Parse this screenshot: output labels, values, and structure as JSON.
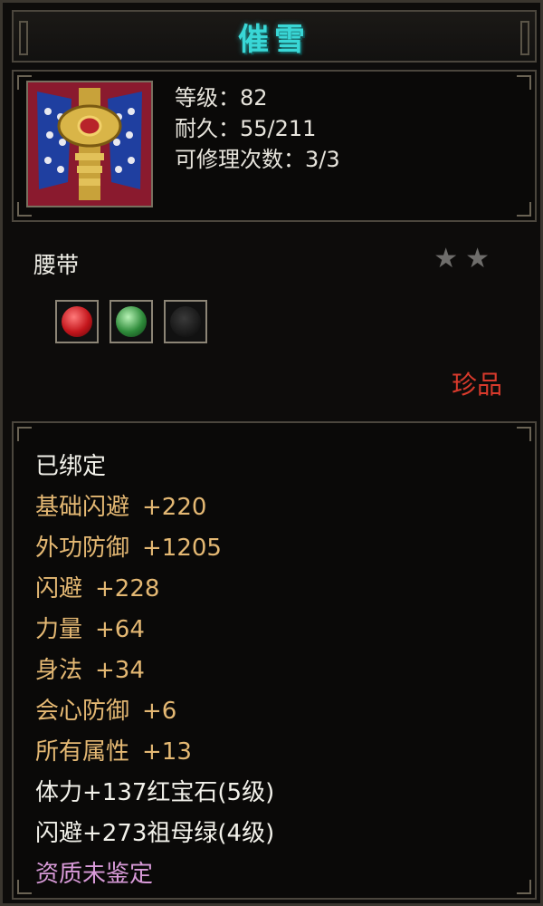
{
  "title": "催雪",
  "info": {
    "icon": "belt-item-icon",
    "level": "等级：82",
    "durability": "耐久：55/211",
    "repairs": "可修理次数：3/3"
  },
  "item_type": "腰带",
  "stars": 2,
  "sockets": [
    {
      "gem": "ruby-gem-icon",
      "color": "#c4161c"
    },
    {
      "gem": "emerald-gem-icon",
      "color": "#2e8b3a"
    },
    {
      "gem": "empty-socket-icon",
      "color": "#151515"
    }
  ],
  "rarity": "珍品",
  "attributes": {
    "bound": "已绑定",
    "rows": [
      {
        "name": "基础闪避",
        "value": "+220"
      },
      {
        "name": "外功防御",
        "value": "+1205"
      },
      {
        "name": "闪避",
        "value": "+228"
      },
      {
        "name": "力量",
        "value": "+64"
      },
      {
        "name": "身法",
        "value": "+34"
      },
      {
        "name": "会心防御",
        "value": "+6"
      },
      {
        "name": "所有属性",
        "value": "+13"
      }
    ],
    "gem_lines": [
      "体力+137红宝石(5级)",
      "闪避+273祖母绿(4级)"
    ],
    "quality": "资质未鉴定"
  },
  "colors": {
    "title": "#39d7d6",
    "attr_gold": "#e4b873",
    "rarity_red": "#d83a2c",
    "quality_pink": "#d89ad8"
  }
}
